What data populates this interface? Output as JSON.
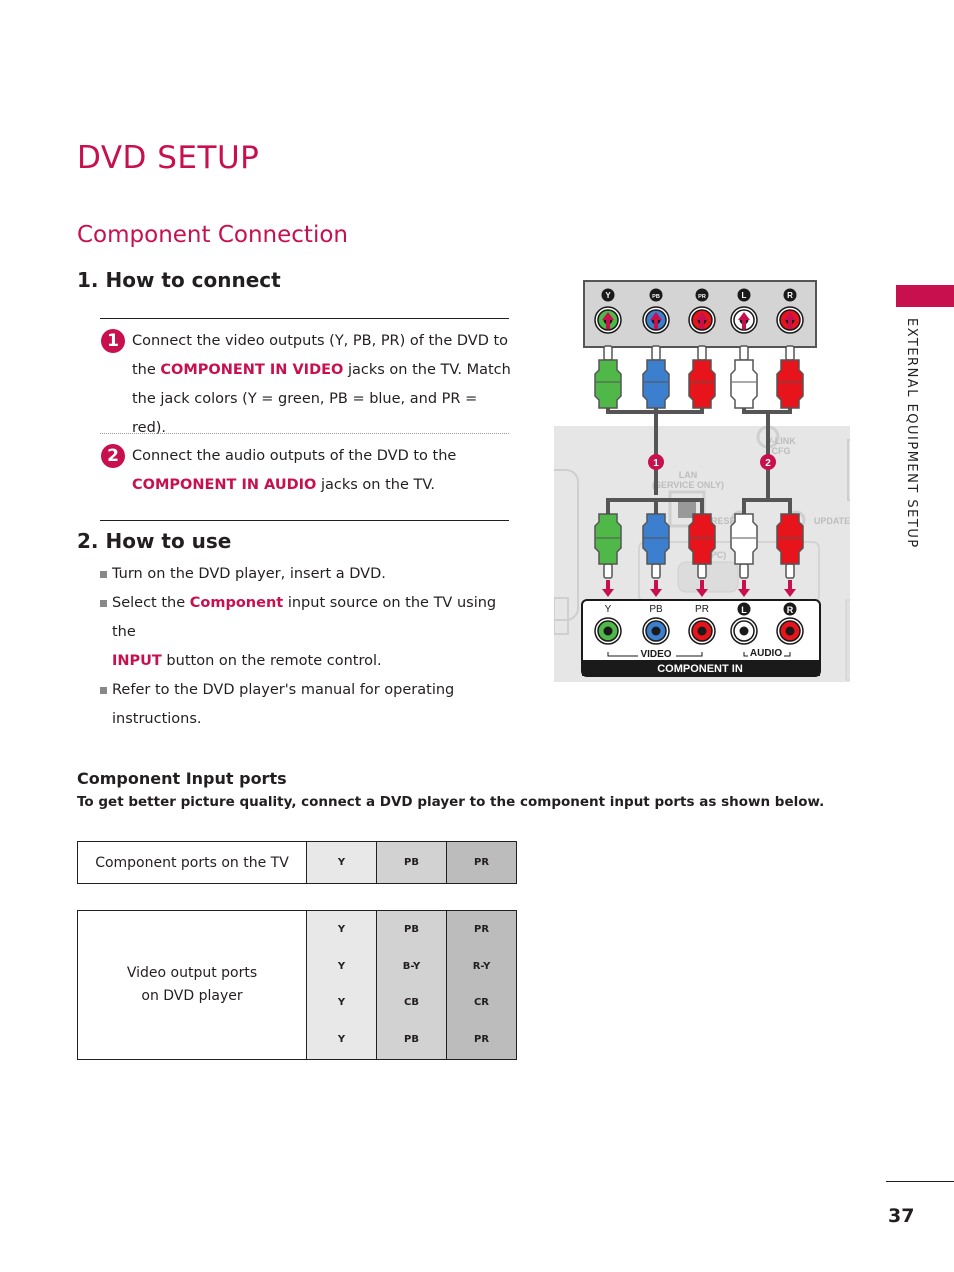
{
  "page": {
    "title": "DVD SETUP",
    "subtitle": "Component Connection",
    "page_number": "37",
    "side_tab": "EXTERNAL EQUIPMENT SETUP",
    "accent_color": "#c8104f"
  },
  "how_to_connect": {
    "heading": "1. How to connect",
    "steps": [
      {
        "number": "1",
        "line1": "Connect the video outputs (Y, PB, PR) of the DVD to",
        "pre": "the ",
        "highlight": "COMPONENT IN VIDEO",
        "post": " jacks on the TV. Match",
        "line3": "the jack colors (Y = green, PB = blue, and PR = red)."
      },
      {
        "number": "2",
        "line1": "Connect the audio outputs of the DVD to the",
        "highlight": "COMPONENT IN AUDIO",
        "post": " jacks on the TV."
      }
    ]
  },
  "how_to_use": {
    "heading": "2. How to use",
    "items": [
      {
        "text": "Turn on the DVD player, insert a DVD."
      },
      {
        "pre": "Select the ",
        "highlight": "Component",
        "mid": " input source on the TV using the",
        "highlight2": "INPUT",
        "post": " button on the remote control."
      },
      {
        "line1": "Refer to the DVD player's manual for operating",
        "line2": "instructions."
      }
    ]
  },
  "diagram": {
    "dvd_jacks": [
      "Y",
      "PB",
      "PR",
      "L",
      "R"
    ],
    "callouts": [
      "1",
      "2"
    ],
    "tv_labels": [
      "LAN",
      "(SERVICE ONLY)",
      "V-LINK",
      "CFG",
      "RESET",
      "UPDATE",
      "(PC)"
    ],
    "tv_jacks": [
      "Y",
      "PB",
      "PR",
      "L",
      "R"
    ],
    "video_label": "VIDEO",
    "audio_label": "AUDIO",
    "panel_label": "COMPONENT IN",
    "colors": {
      "green": "#4fb848",
      "blue": "#3c7fce",
      "red": "#e8141c",
      "white": "#ffffff"
    }
  },
  "component_input_ports": {
    "heading": "Component Input ports",
    "description": "To get better picture quality, connect a DVD player to the component input ports as shown below.",
    "tv_row": {
      "label": "Component ports on the TV",
      "ports": [
        "Y",
        "PB",
        "PR"
      ]
    },
    "dvd_row": {
      "label_line1": "Video output ports",
      "label_line2": "on DVD player",
      "rows": [
        [
          "Y",
          "PB",
          "PR"
        ],
        [
          "Y",
          "B-Y",
          "R-Y"
        ],
        [
          "Y",
          "CB",
          "CR"
        ],
        [
          "Y",
          "PB",
          "PR"
        ]
      ]
    }
  }
}
